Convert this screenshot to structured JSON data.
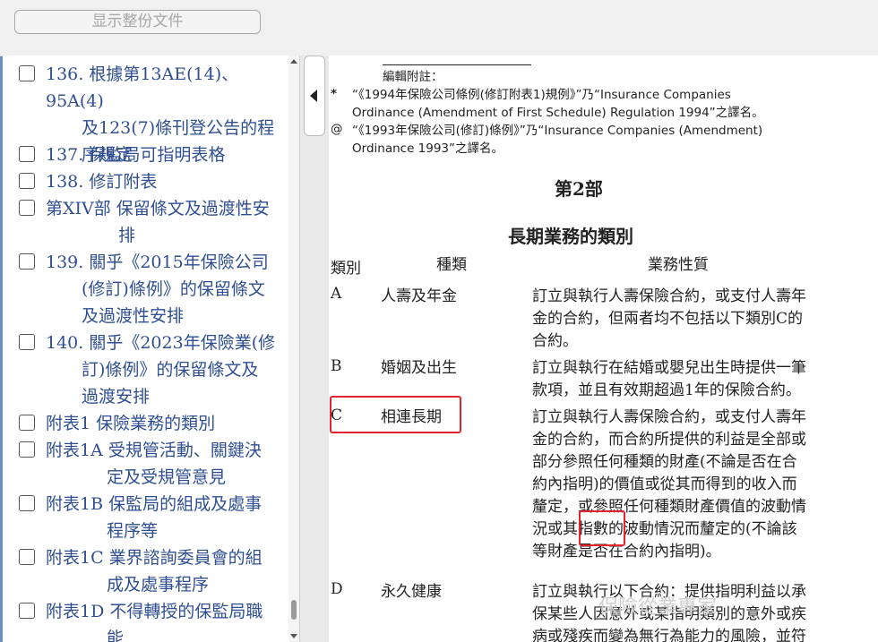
{
  "toolbar": {
    "full_doc_label": "显示整份文件"
  },
  "toc": {
    "items": [
      {
        "line1": "136. 根據第13AE(14)、95A(4)",
        "rest": [
          "及123(7)條刊登公告的程",
          "序規定"
        ]
      },
      {
        "line1": "137. 保監局可指明表格",
        "rest": []
      },
      {
        "line1": "138. 修訂附表",
        "rest": []
      },
      {
        "line1": "第XIV部 保留條文及過渡性安",
        "rest": [
          "排"
        ]
      },
      {
        "line1": "139. 關乎《2015年保險公司",
        "rest": [
          "(修訂)條例》的保留條文",
          "及過渡性安排"
        ]
      },
      {
        "line1": "140. 關乎《2023年保險業(修",
        "rest": [
          "訂)條例》的保留條文及",
          "過渡安排"
        ]
      },
      {
        "line1": "附表1 保險業務的類別",
        "rest": []
      },
      {
        "line1": "附表1A 受規管活動、關鍵決",
        "rest": [
          "定及受規管意見"
        ]
      },
      {
        "line1": "附表1B 保監局的組成及處事",
        "rest": [
          "程序等"
        ]
      },
      {
        "line1": "附表1C 業界諮詢委員會的組",
        "rest": [
          "成及處事程序"
        ]
      },
      {
        "line1": "附表1D 不得轉授的保監局職",
        "rest": [
          "能"
        ]
      }
    ]
  },
  "doc": {
    "editor_note_label": "編輯附註：",
    "notes": [
      {
        "mark": "*",
        "lines": [
          "“《1994年保險公司條例(修訂附表1)規例》”乃“Insurance Companies",
          "Ordinance (Amendment of First Schedule) Regulation 1994”之譯名。"
        ]
      },
      {
        "mark": "@",
        "lines": [
          "“《1993年保險公司(修訂)條例》”乃“Insurance Companies (Amendment)",
          "Ordinance 1993”之譯名。"
        ]
      }
    ],
    "part_heading": "第2部",
    "section_title": "長期業務的類別",
    "columns": {
      "class": "類別",
      "kind": "種類",
      "nature": "業務性質"
    },
    "rows": [
      {
        "class": "A",
        "kind": "人壽及年金",
        "nature": [
          "訂立與執行人壽保險合約，或支付人壽年",
          "金的合約，但兩者均不包括以下類別C的",
          "合約。"
        ]
      },
      {
        "class": "B",
        "kind": "婚姻及出生",
        "nature": [
          "訂立與執行在結婚或嬰兒出生時提供一筆",
          "款項，並且有效期超過1年的保險合約。"
        ]
      },
      {
        "class": "C",
        "kind": "相連長期",
        "nature": [
          "訂立與執行人壽保險合約，或支付人壽年",
          "金的合約，而合約所提供的利益是全部或",
          "部分參照任何種類的財產(不論是否在合",
          "約內指明)的價值或從其而得到的收入而",
          "釐定，或參照任何種類財產價值的波動情",
          "況或其指數的波動情況而釐定的(不論該",
          "等財產是否在合約內指明)。"
        ]
      },
      {
        "class": "D",
        "kind": "永久健康",
        "nature": [
          "訂立與執行以下合約：提供指明利益以承",
          "保某些人因意外或某指明類別的意外或疾",
          "病或殘疾而變為無行為能力的風險，並符"
        ]
      }
    ],
    "watermark": "保險從業專家"
  },
  "colors": {
    "link": "#2f4f92",
    "highlight": "#e5232f",
    "accent": "#6b8fc4"
  }
}
